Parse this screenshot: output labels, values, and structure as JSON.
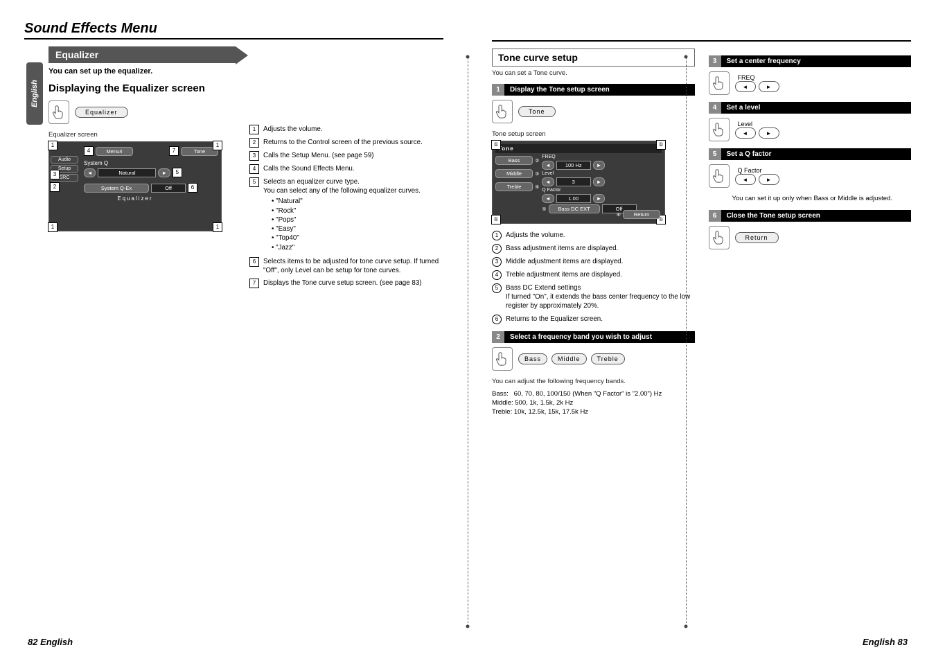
{
  "title": "Sound Effects Menu",
  "lang_tab": "English",
  "footer_left": "82 English",
  "footer_right": "English 83",
  "left": {
    "section_title": "Equalizer",
    "intro": "You can set up the equalizer.",
    "h2": "Displaying the Equalizer screen",
    "touch_label": "Equalizer",
    "screen_caption": "Equalizer screen",
    "eq_screen": {
      "menu4": "Menu4",
      "tone": "Tone",
      "sysq_label": "System Q",
      "sysq_value": "Natural",
      "sysqex_label": "System Q-Ex",
      "sysqex_value": "Off",
      "side": {
        "a": "Audio",
        "b": "Setup",
        "c": "SRC"
      },
      "footer": "Equalizer"
    },
    "items": [
      {
        "n": "1",
        "t": "Adjusts the volume."
      },
      {
        "n": "2",
        "t": "Returns to the Control screen of the previous source."
      },
      {
        "n": "3",
        "t": "Calls the Setup Menu. (see page 59)"
      },
      {
        "n": "4",
        "t": "Calls the Sound Effects Menu."
      },
      {
        "n": "5",
        "t": "Selects an equalizer curve type.",
        "extra": "You can select any of the following equalizer curves.",
        "bullets": [
          "\"Natural\"",
          "\"Rock\"",
          "\"Pops\"",
          "\"Easy\"",
          "\"Top40\"",
          "\"Jazz\""
        ]
      },
      {
        "n": "6",
        "t": "Selects items to be adjusted for tone curve setup. If turned \"Off\", only Level can be setup for tone curves."
      },
      {
        "n": "7",
        "t": "Displays the Tone curve setup screen. (see page 83)"
      }
    ]
  },
  "right": {
    "section_title": "Tone curve setup",
    "intro": "You can set a Tone curve.",
    "step1": {
      "n": "1",
      "t": "Display the Tone setup screen",
      "btn": "Tone"
    },
    "screen_caption": "Tone setup screen",
    "tone_screen": {
      "hdr": "Tone",
      "bass": "Bass",
      "middle": "Middle",
      "treble": "Treble",
      "freq_lbl": "FREQ",
      "freq_val": "100 Hz",
      "level_lbl": "Level",
      "level_val": "3",
      "q_lbl": "Q Factor",
      "q_val": "1.00",
      "dc_lbl": "Bass DC EXT",
      "dc_val": "Off",
      "return": "Return"
    },
    "circle_items": [
      {
        "n": "1",
        "t": "Adjusts the volume."
      },
      {
        "n": "2",
        "t": "Bass adjustment items are displayed."
      },
      {
        "n": "3",
        "t": "Middle adjustment items are displayed."
      },
      {
        "n": "4",
        "t": "Treble adjustment items are displayed."
      },
      {
        "n": "5",
        "t": "Bass DC Extend settings",
        "extra": "If turned \"On\", it extends the bass center frequency to the low register by approximately 20%."
      },
      {
        "n": "6",
        "t": "Returns to the Equalizer screen."
      }
    ],
    "step2": {
      "n": "2",
      "t": "Select a frequency band you wish to adjust",
      "btns": [
        "Bass",
        "Middle",
        "Treble"
      ],
      "note_intro": "You can adjust the following frequency bands.",
      "freq": {
        "bass": "Bass:   60, 70, 80, 100/150 (When \"Q Factor\" is \"2.00\") Hz",
        "middle": "Middle: 500, 1k, 1.5k, 2k Hz",
        "treble": "Treble: 10k, 12.5k, 15k, 17.5k Hz"
      }
    },
    "step3": {
      "n": "3",
      "t": "Set a center frequency",
      "label": "FREQ"
    },
    "step4": {
      "n": "4",
      "t": "Set a level",
      "label": "Level"
    },
    "step5": {
      "n": "5",
      "t": "Set a Q factor",
      "label": "Q Factor",
      "note": "You can set it up only when Bass or Middle is adjusted."
    },
    "step6": {
      "n": "6",
      "t": "Close the Tone setup screen",
      "btn": "Return"
    }
  }
}
